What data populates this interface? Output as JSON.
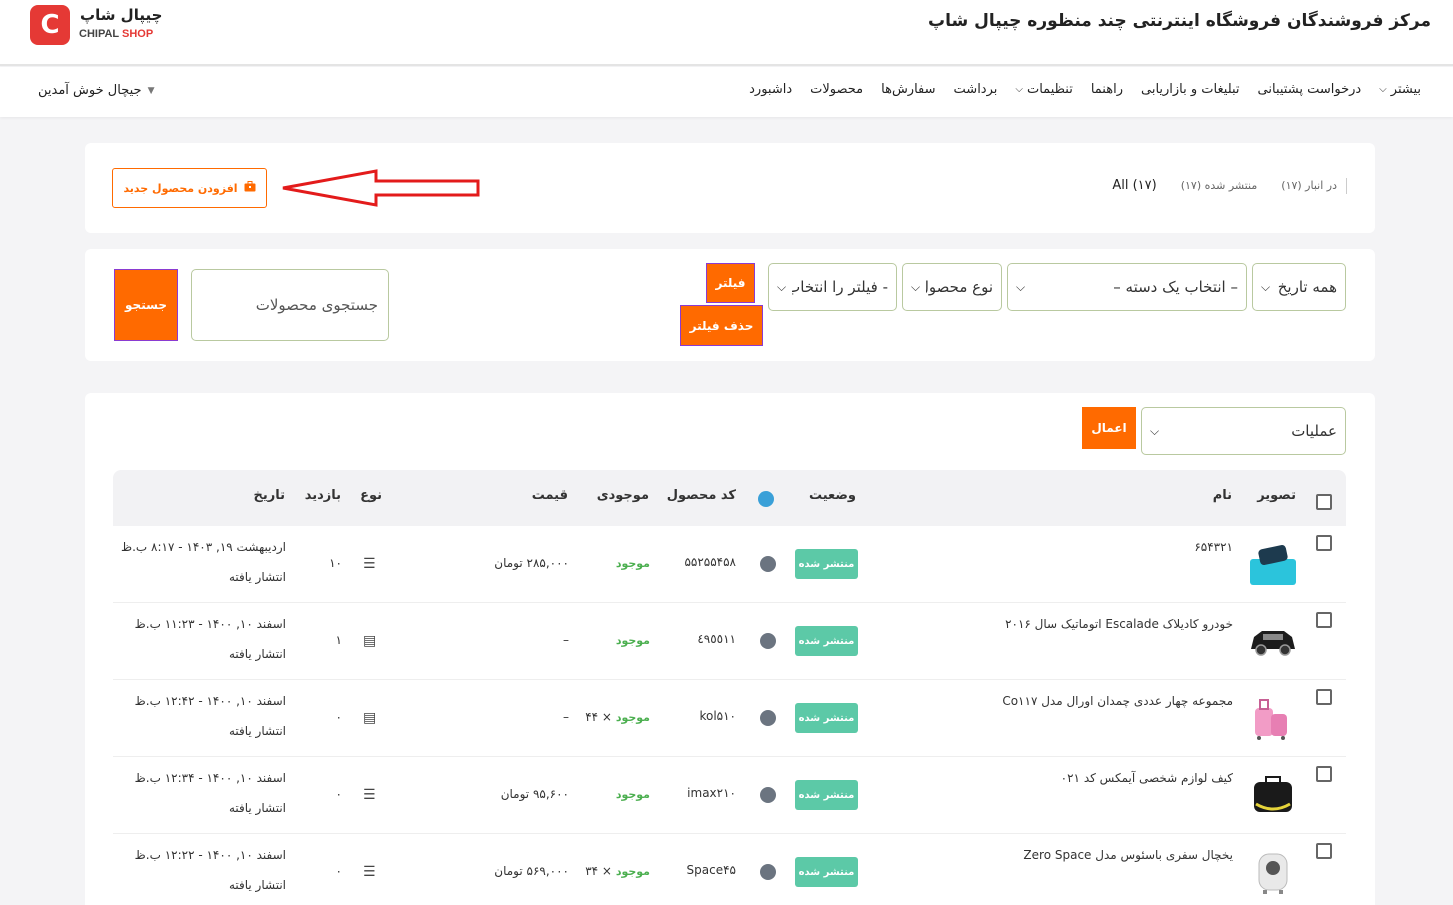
{
  "header": {
    "site_title": "مرکز فروشندگان فروشگاه اینترنتی چند منظوره چیپال شاپ",
    "logo_mark": "C",
    "logo_fa": "چیپال شاپ",
    "logo_en_a": "CHIPAL",
    "logo_en_b": "SHOP"
  },
  "nav": {
    "items": [
      "داشبورد",
      "محصولات",
      "سفارش‌ها",
      "برداشت",
      "تنظیمات",
      "راهنما",
      "تبلیغات و بازاریابی",
      "درخواست پشتیبانی",
      "بیشتر"
    ],
    "user_greeting": "جیچال خوش آمدین"
  },
  "status_bar": {
    "add_product_label": "افزودن محصول جدید",
    "tab_all": "All (۱۷)",
    "tab_published": "منتشر شده (۱۷)",
    "tab_in_stock": "در انبار (۱۷)"
  },
  "filters": {
    "date_select": "همه تاریخ",
    "category_select": "– انتخاب یک دسته –",
    "type_select": "نوع محصول",
    "filter_by": "- فیلتر را انتخاب کنید",
    "filter_button": "فیلتر",
    "remove_filter_button": "حذف فیلتر",
    "search_placeholder": "جستجوی محصولات",
    "search_button": "جستجو"
  },
  "table": {
    "bulk_action": "عملیات",
    "apply_button": "اعمال",
    "headers": {
      "image": "تصویر",
      "name": "نام",
      "status": "وضعیت",
      "sku": "کد محصول",
      "stock": "موجودی",
      "price": "قیمت",
      "type": "نوع",
      "views": "بازدید",
      "date": "تاریخ"
    },
    "rows": [
      {
        "name": "۶۵۴۳۲۱",
        "status": "منتشر شده",
        "sku": "۵۵۲۵۵۴۵۸",
        "stock": "موجود",
        "stock_qty": "",
        "price": "۲۸۵,۰۰۰ تومان",
        "type_icon": "list-icon",
        "views": "۱۰",
        "date": "اردیبهشت ۱۹, ۱۴۰۳ - ۸:۱۷ ب.ظ",
        "date_status": "انتشار یافته",
        "thumb_color": "#2bb0cf"
      },
      {
        "name": "خودرو کادیلاک Escalade اتوماتیک سال ۲۰۱۶",
        "status": "منتشر شده",
        "sku": "٤٩٥٥١١",
        "stock": "موجود",
        "stock_qty": "",
        "price": "–",
        "type_icon": "book-icon",
        "views": "۱",
        "date": "اسفند ۱۰, ۱۴۰۰ - ۱۱:۲۳ ب.ظ",
        "date_status": "انتشار یافته",
        "thumb_color": "#222222"
      },
      {
        "name": "مجموعه چهار عددی چمدان اورال مدل Co۱۱۷",
        "status": "منتشر شده",
        "sku": "kol۵۱۰",
        "stock": "موجود",
        "stock_qty": "× ۴۴",
        "price": "–",
        "type_icon": "book-icon",
        "views": "۰",
        "date": "اسفند ۱۰, ۱۴۰۰ - ۱۲:۴۲ ب.ظ",
        "date_status": "انتشار یافته",
        "thumb_color": "#f0a3c8"
      },
      {
        "name": "کیف لوازم شخصی آیمکس کد ۰۲۱",
        "status": "منتشر شده",
        "sku": "imax۲۱۰",
        "stock": "موجود",
        "stock_qty": "",
        "price": "۹۵,۶۰۰ تومان",
        "type_icon": "list-icon",
        "views": "۰",
        "date": "اسفند ۱۰, ۱۴۰۰ - ۱۲:۳۴ ب.ظ",
        "date_status": "انتشار یافته",
        "thumb_color": "#1a1a1a"
      },
      {
        "name": "یخچال سفری باسئوس مدل Zero Space",
        "status": "منتشر شده",
        "sku": "Space۴۵",
        "stock": "موجود",
        "stock_qty": "× ۳۴",
        "price": "۵۶۹,۰۰۰ تومان",
        "type_icon": "list-icon",
        "views": "۰",
        "date": "اسفند ۱۰, ۱۴۰۰ - ۱۲:۲۲ ب.ظ",
        "date_status": "انتشار یافته",
        "thumb_color": "#dcdcdc"
      }
    ]
  },
  "colors": {
    "accent": "#ff6a00",
    "brand_red": "#e53935",
    "published_badge": "#5cc9a7",
    "in_stock": "#4caf50",
    "annotation_arrow": "#e31b1b"
  }
}
